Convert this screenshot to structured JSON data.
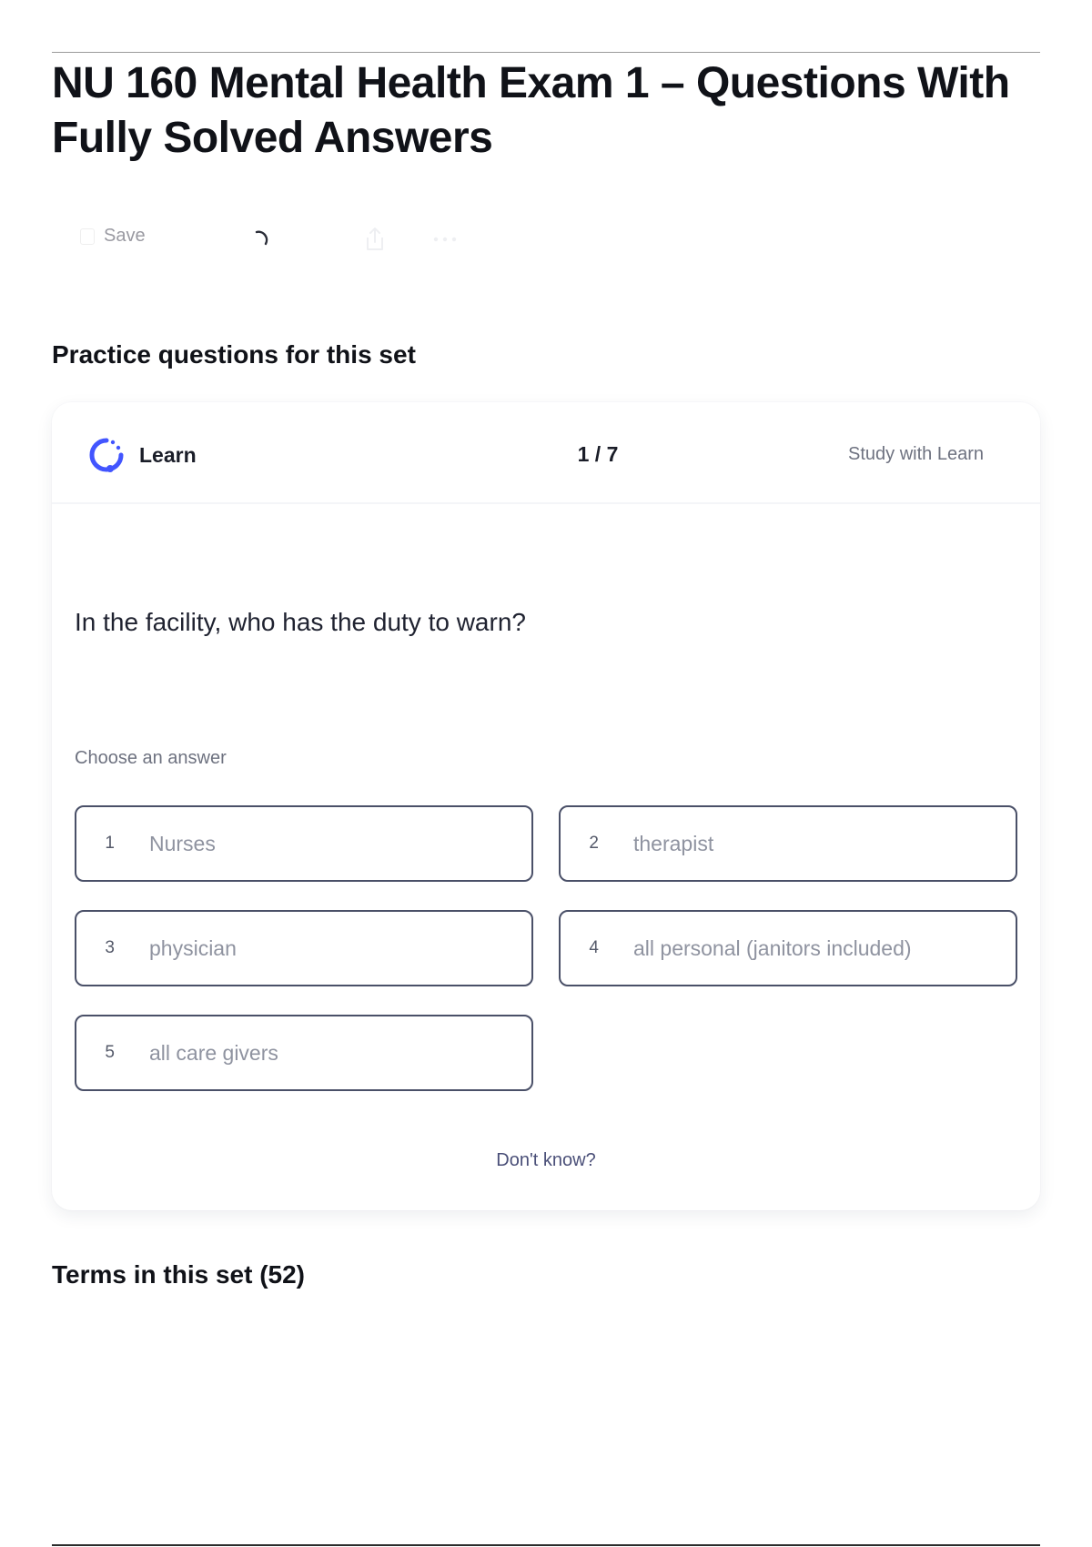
{
  "page": {
    "title": "NU 160 Mental Health Exam 1 – Questions With Fully Solved Answers"
  },
  "toolbar": {
    "save_label": "Save",
    "icons": [
      "save-icon",
      "loading-spinner-icon",
      "share-icon",
      "more-icon"
    ]
  },
  "practice": {
    "heading": "Practice questions for this set",
    "learn_label": "Learn",
    "progress": "1 / 7",
    "study_link": "Study with Learn",
    "question": "In the facility, who has the duty to warn?",
    "choose_label": "Choose an answer",
    "answers": [
      {
        "num": "1",
        "text": "Nurses"
      },
      {
        "num": "2",
        "text": "therapist"
      },
      {
        "num": "3",
        "text": "physician"
      },
      {
        "num": "4",
        "text": "all personal (janitors included)"
      },
      {
        "num": "5",
        "text": "all care givers"
      }
    ],
    "dont_know": "Don't know?"
  },
  "terms": {
    "heading": "Terms in this set (52)"
  },
  "colors": {
    "learn_accent": "#4255ff",
    "answer_border": "#4a5068",
    "link": "#4a4f78"
  }
}
